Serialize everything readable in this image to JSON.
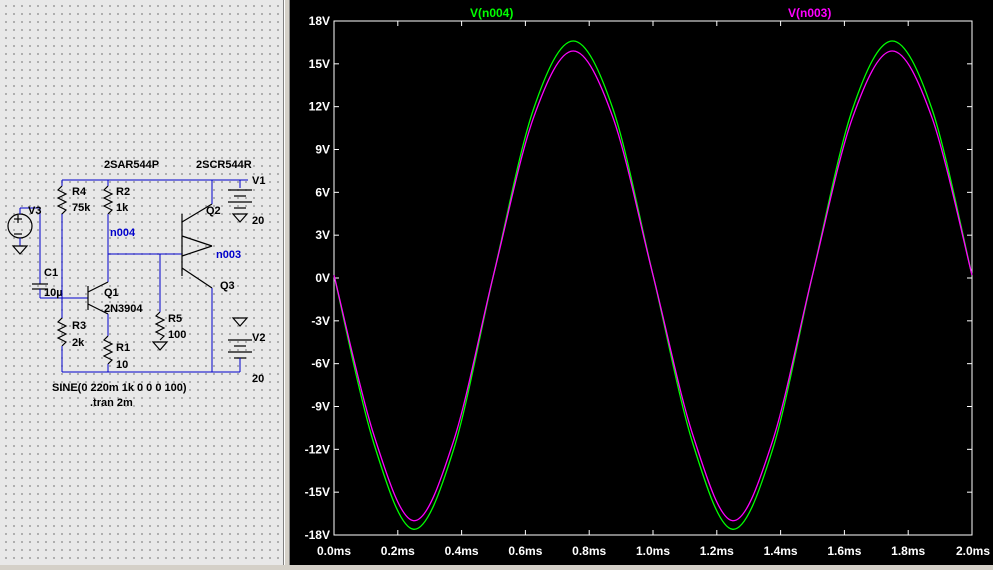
{
  "schematic": {
    "labels": {
      "r4": "R4",
      "r4_val": "75k",
      "r2": "R2",
      "r2_val": "1k",
      "r3": "R3",
      "r3_val": "2k",
      "r1": "R1",
      "r1_val": "10",
      "r5": "R5",
      "r5_val": "100",
      "c1": "C1",
      "c1_val": "10µ",
      "v3": "V3",
      "v1": "V1",
      "v1_val": "20",
      "v2": "V2",
      "v2_val": "20",
      "q1": "Q1",
      "q1_model": "2N3904",
      "q2": "Q2",
      "q2_model": "2SCR544R",
      "q3": "Q3",
      "q3_model": "2SAR544P",
      "net_n004": "n004",
      "net_n003": "n003",
      "sine_directive": "SINE(0 220m 1k 0 0 0 100)",
      "tran_directive": ".tran 2m"
    }
  },
  "plot": {
    "traces": [
      {
        "name": "V(n004)",
        "color": "#00ff00"
      },
      {
        "name": "V(n003)",
        "color": "#ff00ff"
      }
    ]
  },
  "chart_data": {
    "type": "line",
    "xlabel": "",
    "ylabel": "",
    "xlim": [
      0,
      2.0
    ],
    "ylim": [
      -18,
      18
    ],
    "x_ticks": [
      "0.0ms",
      "0.2ms",
      "0.4ms",
      "0.6ms",
      "0.8ms",
      "1.0ms",
      "1.2ms",
      "1.4ms",
      "1.6ms",
      "1.8ms",
      "2.0ms"
    ],
    "y_ticks": [
      "18V",
      "15V",
      "12V",
      "9V",
      "6V",
      "3V",
      "0V",
      "-3V",
      "-6V",
      "-9V",
      "-12V",
      "-15V",
      "-18V"
    ],
    "x": [
      0,
      0.125,
      0.25,
      0.375,
      0.5,
      0.625,
      0.75,
      0.875,
      1.0,
      1.125,
      1.25,
      1.375,
      1.5,
      1.625,
      1.75,
      1.875,
      2.0
    ],
    "series": [
      {
        "name": "V(n004)",
        "color": "#00ff00",
        "values": [
          0.2,
          -11.6,
          -17.6,
          -12.0,
          0.2,
          11.8,
          16.6,
          11.8,
          0.2,
          -11.6,
          -17.6,
          -12.0,
          0.2,
          11.8,
          16.6,
          11.8,
          0.2
        ]
      },
      {
        "name": "V(n003)",
        "color": "#ff00ff",
        "values": [
          0.2,
          -11.0,
          -17.0,
          -11.4,
          0.2,
          11.2,
          15.9,
          11.2,
          0.2,
          -11.0,
          -17.0,
          -11.4,
          0.2,
          11.2,
          15.9,
          11.2,
          0.2
        ]
      }
    ]
  }
}
